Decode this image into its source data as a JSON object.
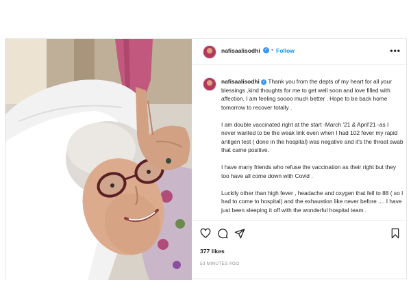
{
  "post": {
    "username": "nafisaalisodhi",
    "verified": true,
    "follow_label": "Follow",
    "more_label": "•••",
    "caption_paragraphs": [
      "Thank you from the depts of my heart for all your blessings ,kind thoughts for me to get well soon and love filled with affection. I am feeling soooo much better . Hope to be back home tomorrow to recover totally .",
      "I am double vaccinated right at the start -March '21 & April'21 -as I never wanted to be the weak link even when I had 102 fever my rapid antigen test ( done in the hospital) was negative and it's the throat swab that came positive.",
      "I have many friends who refuse the vaccination as their right but they too have all come down with Covid .",
      "Luckily other than high fever , headache and oxygen that fell to 88 ( so I had to come to hospital) and the exhaustion like never before .... I have just been sleeping it off with the wonderful hospital team ."
    ],
    "likes": "377 likes",
    "timestamp": "53 MINUTES AGO"
  },
  "colors": {
    "accent": "#0095f6",
    "verified": "#3897f0",
    "muted": "#8e8e8e"
  }
}
